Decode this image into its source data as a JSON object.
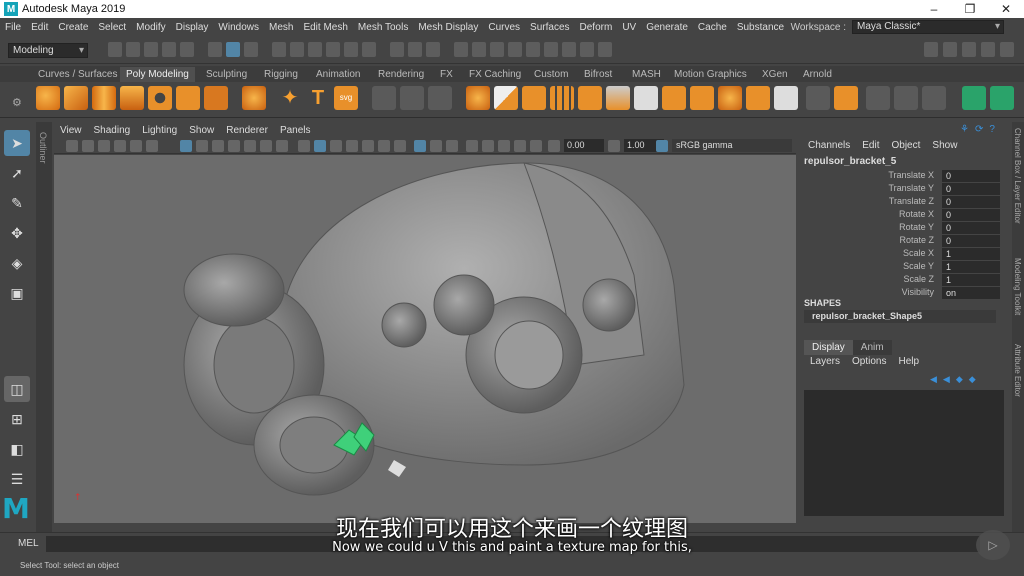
{
  "window": {
    "title": "Autodesk Maya 2019",
    "minimize": "–",
    "maximize": "❐",
    "close": "✕"
  },
  "menubar": [
    "File",
    "Edit",
    "Create",
    "Select",
    "Modify",
    "Display",
    "Windows",
    "Mesh",
    "Edit Mesh",
    "Mesh Tools",
    "Mesh Display",
    "Curves",
    "Surfaces",
    "Deform",
    "UV",
    "Generate",
    "Cache",
    "Substance"
  ],
  "workspace": {
    "label": "Workspace :",
    "value": "Maya Classic*"
  },
  "statusline": {
    "mode": "Modeling"
  },
  "shelf_tabs": [
    "Curves / Surfaces",
    "Poly Modeling",
    "Sculpting",
    "Rigging",
    "Animation",
    "Rendering",
    "FX",
    "FX Caching",
    "Custom",
    "Bifrost",
    "MASH",
    "Motion Graphics",
    "XGen",
    "Arnold"
  ],
  "shelf_active": "Poly Modeling",
  "viewport_menu": [
    "View",
    "Shading",
    "Lighting",
    "Show",
    "Renderer",
    "Panels"
  ],
  "viewport_toolbar": {
    "exposure": "0.00",
    "gamma": "1.00",
    "colorspace": "sRGB gamma"
  },
  "outliner_label": "Outliner",
  "channel_box": {
    "menu": [
      "Channels",
      "Edit",
      "Object",
      "Show"
    ],
    "object": "repulsor_bracket_5",
    "attributes": [
      {
        "name": "Translate X",
        "value": "0"
      },
      {
        "name": "Translate Y",
        "value": "0"
      },
      {
        "name": "Translate Z",
        "value": "0"
      },
      {
        "name": "Rotate X",
        "value": "0"
      },
      {
        "name": "Rotate Y",
        "value": "0"
      },
      {
        "name": "Rotate Z",
        "value": "0"
      },
      {
        "name": "Scale X",
        "value": "1"
      },
      {
        "name": "Scale Y",
        "value": "1"
      },
      {
        "name": "Scale Z",
        "value": "1"
      },
      {
        "name": "Visibility",
        "value": "on"
      }
    ],
    "shapes_header": "SHAPES",
    "shape": "repulsor_bracket_Shape5"
  },
  "layer_editor": {
    "tabs": [
      "Display",
      "Anim"
    ],
    "menu": [
      "Layers",
      "Options",
      "Help"
    ]
  },
  "side_tabs": [
    "Channel Box / Layer Editor",
    "Modeling Toolkit",
    "Attribute Editor"
  ],
  "command_line": {
    "label": "MEL"
  },
  "help_line": "Select Tool: select an object",
  "subtitles": {
    "zh": "现在我们可以用这个来画一个纹理图",
    "en": "Now we could u V this and paint a texture map for this,"
  }
}
